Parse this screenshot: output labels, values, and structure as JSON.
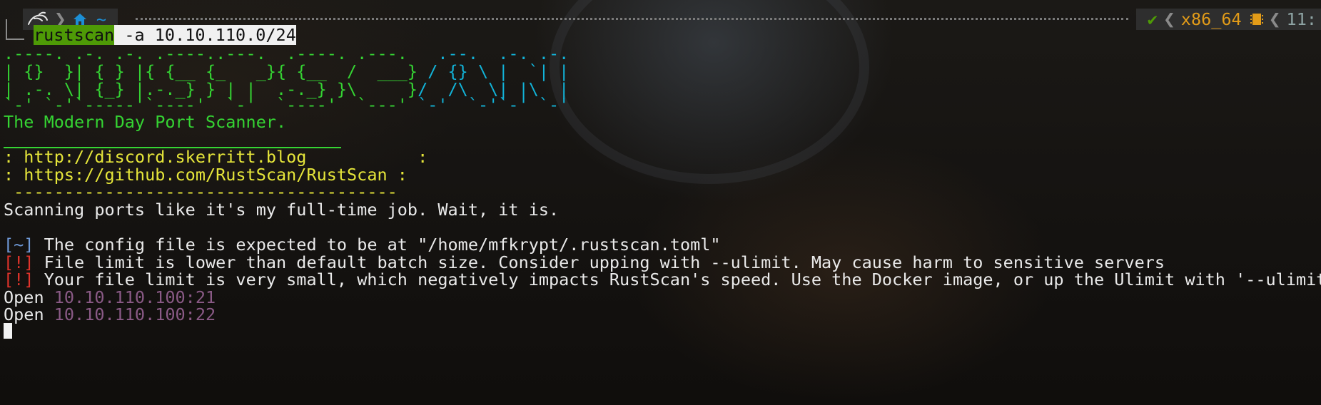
{
  "prompt": {
    "home_label": "~",
    "status_check": "✔",
    "arch": "x86_64",
    "time_partial": "11:"
  },
  "command": {
    "name": "rustscan",
    "args": " -a 10.10.110.0/24"
  },
  "banner": {
    "art_line1_green": ".----. .-. .-. .----..---.  .----. .---.",
    "art_line1_cyan": "   .--.  .-. .-.",
    "art_line2_green": "| {}  }| { } |{ {__ {_   _}{ {__  /  ___}",
    "art_line2_cyan": " / {} \\ |  `| |",
    "art_line3_green": "| .-. \\| {_} |.-._} } | |  .-._} }\\     }",
    "art_line3_cyan": "/  /\\  \\| |\\  |",
    "art_line4_green": "`-' `-'`-----'`----'  `-'  `----'  `---' ",
    "art_line4_cyan": "`-'  `-'`-' `-'",
    "tagline": "The Modern Day Port Scanner.",
    "link1": ": http://discord.skerritt.blog           :",
    "link2": ": https://github.com/RustScan/RustScan :",
    "link_footer": " --------------------------------------"
  },
  "output": {
    "motto": "Scanning ports like it's my full-time job. Wait, it is.",
    "info_tag": "[~]",
    "info_text": " The config file is expected to be at \"/home/mfkrypt/.rustscan.toml\"",
    "warn1_tag": "[!]",
    "warn1_text": " File limit is lower than default batch size. Consider upping with --ulimit. May cause harm to sensitive servers",
    "warn2_tag": "[!]",
    "warn2_text": " Your file limit is very small, which negatively impacts RustScan's speed. Use the Docker image, or up the Ulimit with '--ulimit",
    "open1_label": "Open ",
    "open1_addr": "10.10.110.100:21",
    "open2_label": "Open ",
    "open2_addr": "10.10.110.100:22"
  },
  "colors": {
    "green": "#35d433",
    "cyan": "#12b3d8",
    "yellow": "#e6e63a",
    "blue": "#6f9ad8",
    "red": "#e0332b",
    "purple": "#8a5a86",
    "orange": "#e39c18"
  },
  "icons": [
    "kali-dragon-icon",
    "home-icon",
    "chip-icon"
  ]
}
